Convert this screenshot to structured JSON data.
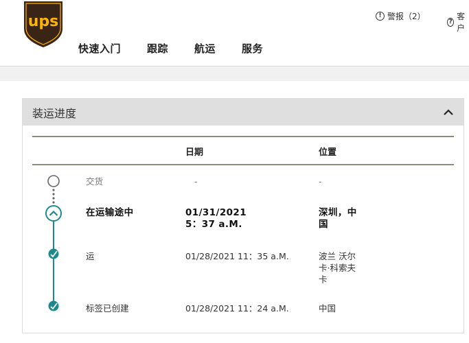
{
  "header": {
    "nav": [
      "快速入门",
      "跟踪",
      "航运",
      "服务"
    ],
    "alerts_label": "警报（2）",
    "support_label": "客户"
  },
  "panel": {
    "title": "装运进度",
    "columns": {
      "date": "日期",
      "location": "位置"
    },
    "rows": [
      {
        "status": "交货",
        "date": "-",
        "location": "-",
        "state": "pending"
      },
      {
        "status": "在运输途中",
        "date_line1": "01/31/2021",
        "date_line2": "5：37 a.M.",
        "location_line1": "深圳，中",
        "location_line2": "国",
        "state": "current"
      },
      {
        "status": "运",
        "date": "01/28/2021  11：35 a.M.",
        "location_line1": "波兰 沃尔",
        "location_line2": "卡·科索夫",
        "location_line3": "卡",
        "state": "done"
      },
      {
        "status": "标签已创建",
        "date": "01/28/2021  11：24 a.M.",
        "location": "中国",
        "state": "done"
      }
    ]
  },
  "colors": {
    "teal": "#1b8a8f",
    "ups_brown": "#3a2415",
    "ups_gold": "#ffb500"
  }
}
